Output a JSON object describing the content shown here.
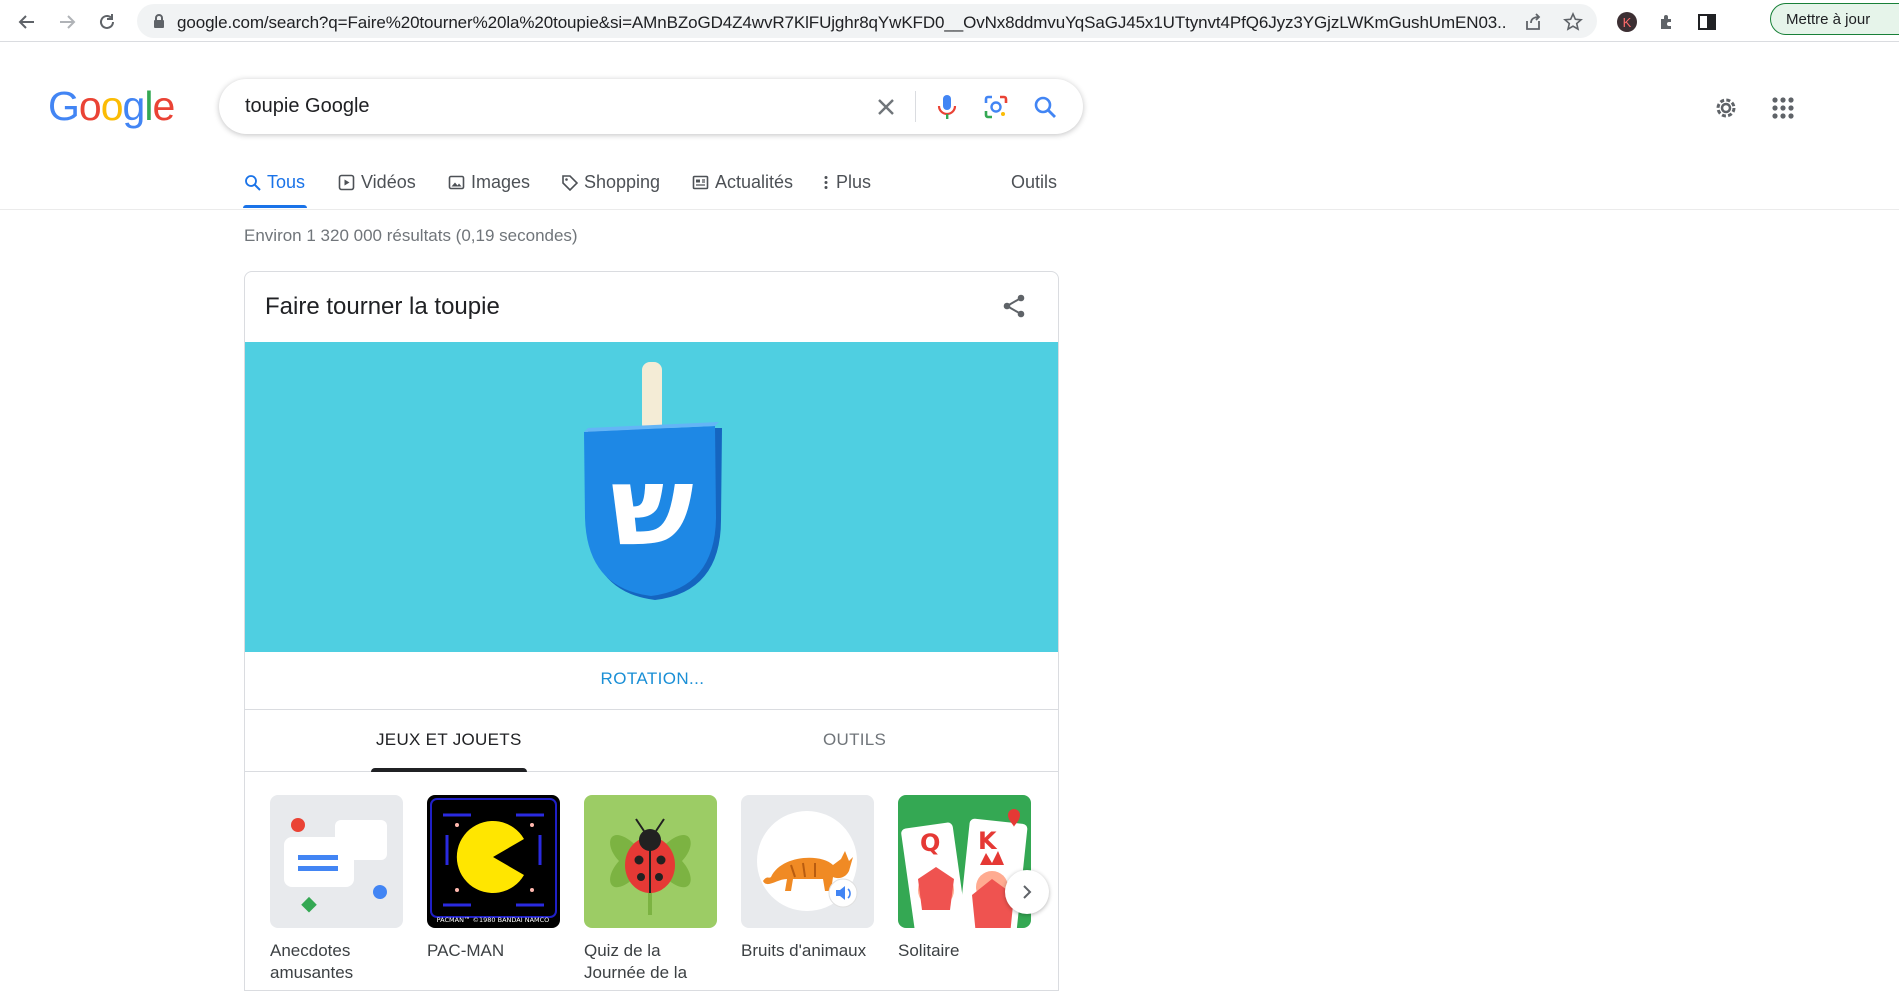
{
  "browser": {
    "url": "google.com/search?q=Faire%20tourner%20la%20toupie&si=AMnBZoGD4Z4wvR7KlFUjghr8qYwKFD0__OvNx8ddmvuYqSaGJ45x1UTtynvt4PfQ6Jyz3YGjzLWKmGushUmEN03...",
    "update_label": "Mettre à jour",
    "profile_initial": "K"
  },
  "google": {
    "logo_letters": [
      "G",
      "o",
      "o",
      "g",
      "l",
      "e"
    ],
    "logo_colors": [
      "#4285f4",
      "#ea4335",
      "#fbbc05",
      "#4285f4",
      "#34a853",
      "#ea4335"
    ]
  },
  "search": {
    "value": "toupie Google"
  },
  "tabs": [
    {
      "label": "Tous",
      "icon": "search-icon",
      "active": true
    },
    {
      "label": "Vidéos",
      "icon": "video-icon"
    },
    {
      "label": "Images",
      "icon": "image-icon"
    },
    {
      "label": "Shopping",
      "icon": "tag-icon"
    },
    {
      "label": "Actualités",
      "icon": "news-icon"
    },
    {
      "label": "Plus",
      "icon": "more-vert-icon"
    }
  ],
  "tools_label": "Outils",
  "stats": "Environ 1 320 000 résultats (0,19 secondes)",
  "card": {
    "title": "Faire tourner la toupie",
    "dreidel_letter": "ש",
    "rotation_label": "ROTATION...",
    "categories": [
      {
        "label": "JEUX ET JOUETS",
        "active": true
      },
      {
        "label": "OUTILS",
        "active": false
      }
    ],
    "tiles": [
      {
        "label": "Anecdotes amusantes"
      },
      {
        "label": "PAC-MAN",
        "caption": "PACMAN™ ©1980 BANDAI NAMCO"
      },
      {
        "label": "Quiz de la Journée de la"
      },
      {
        "label": "Bruits d'animaux"
      },
      {
        "label": "Solitaire",
        "cards": [
          "Q",
          "K"
        ]
      }
    ]
  },
  "colors": {
    "accent": "#1a73e8",
    "spinner_bg": "#4fcfe1",
    "dreidel": "#1a7fdc"
  }
}
